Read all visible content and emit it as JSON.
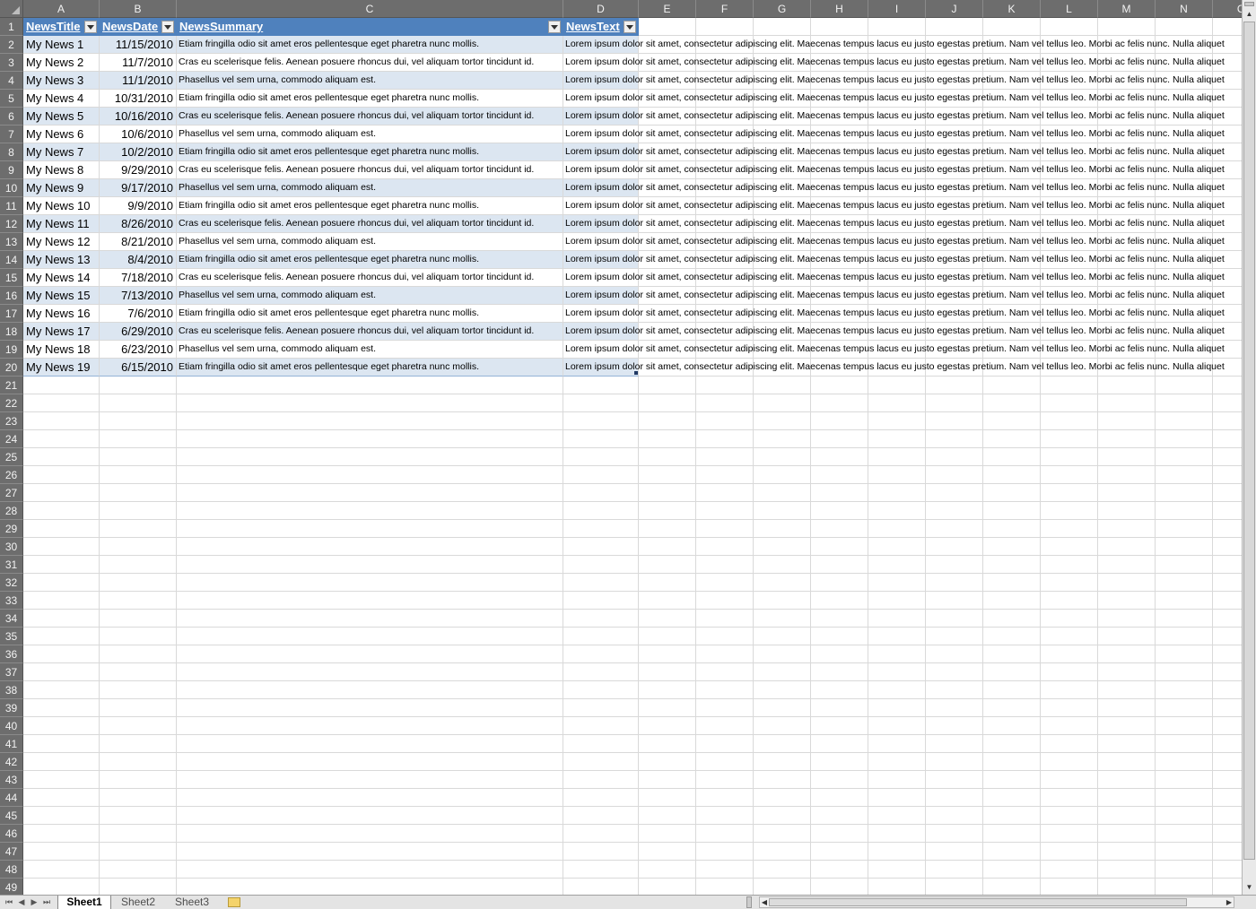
{
  "columns": [
    "A",
    "B",
    "C",
    "D",
    "E",
    "F",
    "G",
    "H",
    "I",
    "J",
    "K",
    "L",
    "M",
    "N",
    "O"
  ],
  "headers": {
    "title": "NewsTitle",
    "date": "NewsDate",
    "summary": "NewsSummary",
    "text": "NewsText"
  },
  "rows": [
    {
      "title": "My News 1",
      "date": "11/15/2010",
      "summary": "Etiam fringilla odio sit amet eros pellentesque eget pharetra nunc mollis."
    },
    {
      "title": "My News 2",
      "date": "11/7/2010",
      "summary": "Cras eu scelerisque felis. Aenean posuere rhoncus dui, vel aliquam tortor tincidunt id."
    },
    {
      "title": "My News 3",
      "date": "11/1/2010",
      "summary": "Phasellus vel sem urna, commodo aliquam est."
    },
    {
      "title": "My News 4",
      "date": "10/31/2010",
      "summary": "Etiam fringilla odio sit amet eros pellentesque eget pharetra nunc mollis."
    },
    {
      "title": "My News 5",
      "date": "10/16/2010",
      "summary": "Cras eu scelerisque felis. Aenean posuere rhoncus dui, vel aliquam tortor tincidunt id."
    },
    {
      "title": "My News 6",
      "date": "10/6/2010",
      "summary": "Phasellus vel sem urna, commodo aliquam est."
    },
    {
      "title": "My News 7",
      "date": "10/2/2010",
      "summary": "Etiam fringilla odio sit amet eros pellentesque eget pharetra nunc mollis."
    },
    {
      "title": "My News 8",
      "date": "9/29/2010",
      "summary": "Cras eu scelerisque felis. Aenean posuere rhoncus dui, vel aliquam tortor tincidunt id."
    },
    {
      "title": "My News 9",
      "date": "9/17/2010",
      "summary": "Phasellus vel sem urna, commodo aliquam est."
    },
    {
      "title": "My News 10",
      "date": "9/9/2010",
      "summary": "Etiam fringilla odio sit amet eros pellentesque eget pharetra nunc mollis."
    },
    {
      "title": "My News 11",
      "date": "8/26/2010",
      "summary": "Cras eu scelerisque felis. Aenean posuere rhoncus dui, vel aliquam tortor tincidunt id."
    },
    {
      "title": "My News 12",
      "date": "8/21/2010",
      "summary": "Phasellus vel sem urna, commodo aliquam est."
    },
    {
      "title": "My News 13",
      "date": "8/4/2010",
      "summary": "Etiam fringilla odio sit amet eros pellentesque eget pharetra nunc mollis."
    },
    {
      "title": "My News 14",
      "date": "7/18/2010",
      "summary": "Cras eu scelerisque felis. Aenean posuere rhoncus dui, vel aliquam tortor tincidunt id."
    },
    {
      "title": "My News 15",
      "date": "7/13/2010",
      "summary": "Phasellus vel sem urna, commodo aliquam est."
    },
    {
      "title": "My News 16",
      "date": "7/6/2010",
      "summary": "Etiam fringilla odio sit amet eros pellentesque eget pharetra nunc mollis."
    },
    {
      "title": "My News 17",
      "date": "6/29/2010",
      "summary": "Cras eu scelerisque felis. Aenean posuere rhoncus dui, vel aliquam tortor tincidunt id."
    },
    {
      "title": "My News 18",
      "date": "6/23/2010",
      "summary": "Phasellus vel sem urna, commodo aliquam est."
    },
    {
      "title": "My News 19",
      "date": "6/15/2010",
      "summary": "Etiam fringilla odio sit amet eros pellentesque eget pharetra nunc mollis."
    }
  ],
  "news_text": "Lorem ipsum dolor sit amet, consectetur adipiscing elit. Maecenas tempus lacus eu justo egestas pretium. Nam vel tellus leo. Morbi ac felis nunc. Nulla aliquet",
  "row_count": 49,
  "sheet_tabs": [
    "Sheet1",
    "Sheet2",
    "Sheet3"
  ],
  "active_sheet": "Sheet1",
  "colors": {
    "header_fill": "#4f81bd",
    "band_fill": "#dce6f1",
    "heading_gray": "#6d6d6d"
  }
}
